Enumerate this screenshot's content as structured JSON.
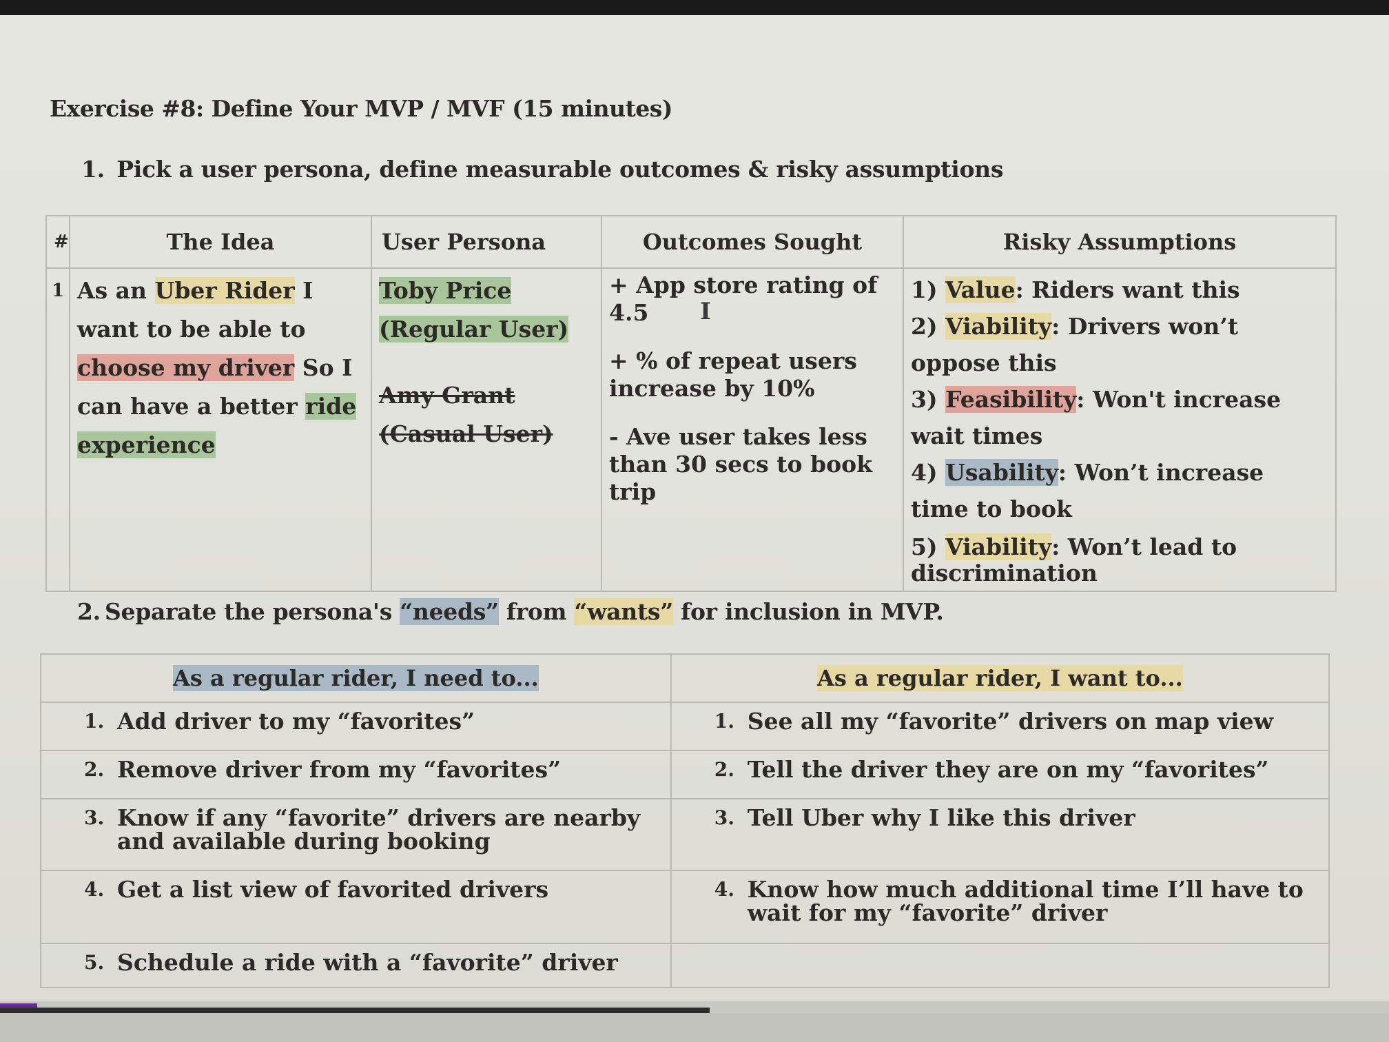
{
  "heading": "Exercise #8: Define Your MVP / MVF (15 minutes)",
  "step1": {
    "num": "1.",
    "text": "Pick a user persona, define measurable outcomes & risky assumptions"
  },
  "table1": {
    "headers": {
      "num": "#",
      "idea": "The Idea",
      "persona": "User Persona",
      "outcomes": "Outcomes Sought",
      "risks": "Risky Assumptions"
    },
    "row": {
      "num": "1",
      "idea": {
        "p1": "As an ",
        "hl_rider": "Uber Rider",
        "p2": " I want to be able to ",
        "hl_choose": "choose my driver",
        "p3": " So I can have a better ",
        "hl_experience": "ride experience"
      },
      "persona_selected": "Toby Price (Regular User)",
      "persona_struck": "Amy Grant (Casual User)",
      "outcomes": [
        "+ App store rating of 4.5",
        "+ % of repeat users increase by 10%",
        "- Ave user takes less than 30 secs to book trip"
      ],
      "risks": [
        {
          "num": "1)",
          "label": "Value",
          "text": ": Riders want this"
        },
        {
          "num": "2)",
          "label": "Viability",
          "text": ": Drivers won’t oppose this"
        },
        {
          "num": "3)",
          "label": "Feasibility",
          "text": ": Won't increase wait times"
        },
        {
          "num": "4)",
          "label": "Usability",
          "text": ": Won’t increase time to book"
        },
        {
          "num": "5)",
          "label": "Viability",
          "text": ": Won’t lead to discrimination"
        }
      ]
    }
  },
  "step2": {
    "num": "2.",
    "p1": "Separate the persona's ",
    "needs": "“needs”",
    "p2": " from ",
    "wants": "“wants”",
    "p3": " for inclusion in MVP."
  },
  "table2": {
    "need_header": "As a regular rider, I need to...",
    "want_header": "As a regular rider, I want to...",
    "needs": [
      {
        "n": "1.",
        "t": "Add driver to my “favorites”"
      },
      {
        "n": "2.",
        "t": "Remove driver from my “favorites”"
      },
      {
        "n": "3.",
        "t": "Know if any “favorite” drivers are nearby and available during booking"
      },
      {
        "n": "4.",
        "t": "Get a list view of favorited drivers"
      },
      {
        "n": "5.",
        "t": "Schedule a ride with a “favorite” driver"
      }
    ],
    "wants": [
      {
        "n": "1.",
        "t": "See all my “favorite” drivers on map view"
      },
      {
        "n": "2.",
        "t": "Tell the driver they are on my “favorites”"
      },
      {
        "n": "3.",
        "t": "Tell Uber why I like this driver"
      },
      {
        "n": "4.",
        "t": "Know how much additional time I’ll have to wait for my “favorite” driver"
      }
    ]
  },
  "colors": {
    "highlight_yellow": "#e7d9a3",
    "highlight_red": "#e0a39c",
    "highlight_green": "#a8c69a",
    "highlight_blue": "#a9bac6"
  }
}
